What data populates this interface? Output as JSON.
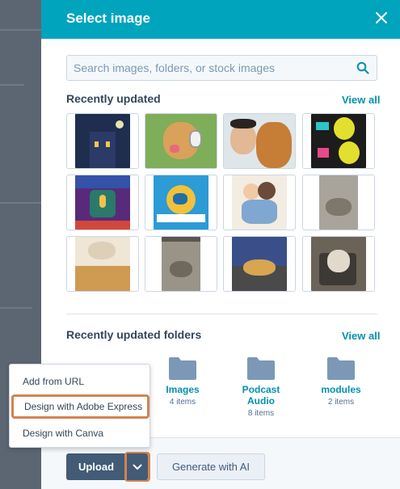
{
  "modal": {
    "title": "Select image",
    "close_icon": "close-icon"
  },
  "search": {
    "placeholder": "Search images, folders, or stock images",
    "icon": "search-icon"
  },
  "recent_images": {
    "title": "Recently updated",
    "view_all": "View all",
    "items": [
      {
        "name": "haunted-house-illustration",
        "color": "#1f2d4f"
      },
      {
        "name": "dog-with-headphones",
        "color": "#d9a15a"
      },
      {
        "name": "man-with-dog-selfie",
        "color": "#c79a6a"
      },
      {
        "name": "lemons-pattern",
        "color": "#1c1c1c"
      },
      {
        "name": "podcast-illustration",
        "color": "#5a2a7a"
      },
      {
        "name": "globe-infographic",
        "color": "#2c9bd6"
      },
      {
        "name": "kids-hugging-illustration",
        "color": "#f3ece2"
      },
      {
        "name": "cat-on-floor",
        "color": "#8d8b85"
      },
      {
        "name": "cat-sketch-photo",
        "color": "#e8d7b9"
      },
      {
        "name": "cat-under-chair",
        "color": "#9a9488"
      },
      {
        "name": "cat-on-blanket",
        "color": "#c79a4f"
      },
      {
        "name": "cat-on-chair",
        "color": "#4f4b47"
      }
    ]
  },
  "folders": {
    "title": "Recently updated folders",
    "view_all": "View all",
    "items": [
      {
        "name": "Images",
        "count": "4 items"
      },
      {
        "name": "Podcast Audio",
        "count": "8 items"
      },
      {
        "name": "modules",
        "count": "2 items"
      }
    ]
  },
  "upload_menu": {
    "items": [
      {
        "label": "Add from URL"
      },
      {
        "label": "Design with Adobe Express"
      },
      {
        "label": "Design with Canva"
      }
    ]
  },
  "footer": {
    "upload_label": "Upload",
    "generate_label": "Generate with AI"
  },
  "colors": {
    "header": "#00a4bd",
    "link": "#0091ae",
    "primary_button": "#425b76",
    "highlight": "#d4834f"
  }
}
